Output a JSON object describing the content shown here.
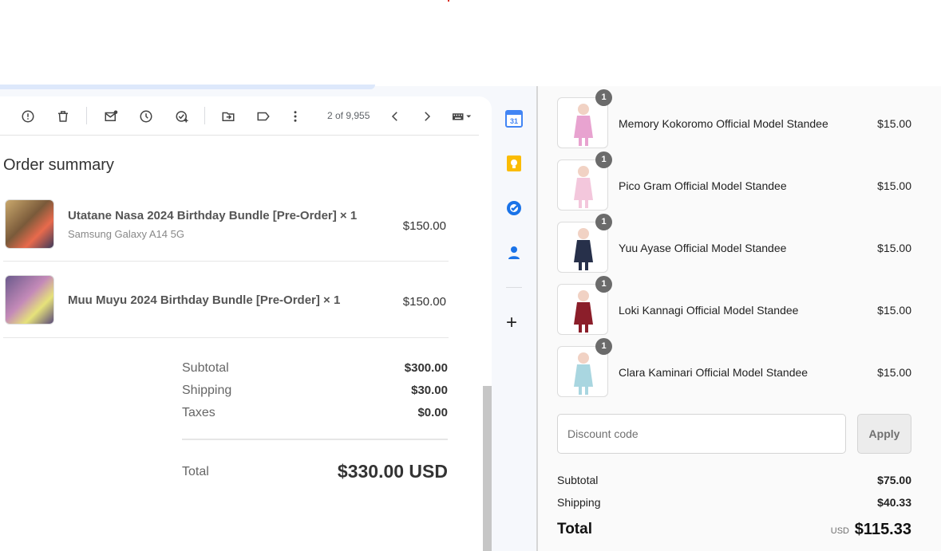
{
  "gmail": {
    "toolbar": {
      "page_count": "2 of 9,955"
    },
    "order": {
      "title": "Order summary",
      "items": [
        {
          "name": "Utatane Nasa 2024 Birthday Bundle [Pre-Order] × 1",
          "variant": "Samsung Galaxy A14 5G",
          "price": "$150.00"
        },
        {
          "name": "Muu Muyu 2024 Birthday Bundle [Pre-Order] × 1",
          "variant": "",
          "price": "$150.00"
        }
      ],
      "subtotal_label": "Subtotal",
      "subtotal_value": "$300.00",
      "shipping_label": "Shipping",
      "shipping_value": "$30.00",
      "taxes_label": "Taxes",
      "taxes_value": "$0.00",
      "total_label": "Total",
      "total_value": "$330.00 USD"
    }
  },
  "rail": {
    "calendar_date": "31"
  },
  "shop": {
    "items": [
      {
        "qty": "1",
        "name": "Memory Kokoromo Official Model Standee",
        "price": "$15.00",
        "color": "#e8a3d0"
      },
      {
        "qty": "1",
        "name": "Pico Gram Official Model Standee",
        "price": "$15.00",
        "color": "#f3c7dc"
      },
      {
        "qty": "1",
        "name": "Yuu Ayase Official Model Standee",
        "price": "$15.00",
        "color": "#27304a"
      },
      {
        "qty": "1",
        "name": "Loki Kannagi Official Model Standee",
        "price": "$15.00",
        "color": "#8b1e2a"
      },
      {
        "qty": "1",
        "name": "Clara Kaminari Official Model Standee",
        "price": "$15.00",
        "color": "#a9d6e0"
      }
    ],
    "discount_placeholder": "Discount code",
    "apply_label": "Apply",
    "subtotal_label": "Subtotal",
    "subtotal_value": "$75.00",
    "shipping_label": "Shipping",
    "shipping_value": "$40.33",
    "total_label": "Total",
    "currency": "USD",
    "total_value": "$115.33"
  }
}
